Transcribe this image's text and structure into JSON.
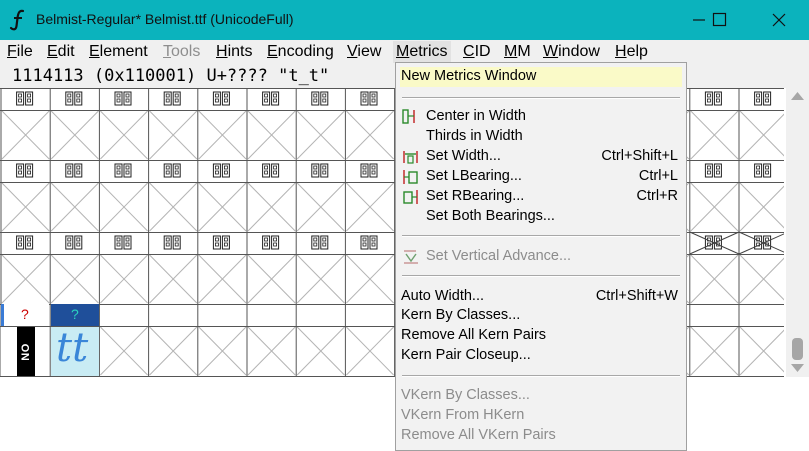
{
  "window": {
    "title": "Belmist-Regular*  Belmist.ttf (UnicodeFull)",
    "accent": "#0bb3bd"
  },
  "menubar": [
    {
      "label": "File",
      "state": "normal"
    },
    {
      "label": "Edit",
      "state": "normal"
    },
    {
      "label": "Element",
      "state": "normal"
    },
    {
      "label": "Tools",
      "state": "disabled"
    },
    {
      "label": "Hints",
      "state": "normal"
    },
    {
      "label": "Encoding",
      "state": "normal"
    },
    {
      "label": "View",
      "state": "normal"
    },
    {
      "label": "Metrics",
      "state": "active"
    },
    {
      "label": "CID",
      "state": "normal"
    },
    {
      "label": "MM",
      "state": "normal"
    },
    {
      "label": "Window",
      "state": "normal"
    },
    {
      "label": "Help",
      "state": "normal"
    }
  ],
  "infobar": {
    "text": "1114113 (0x110001) U+???? \"t_t\""
  },
  "glyph_grid": {
    "empty_label_glyph": "⊡⊡",
    "last_row": [
      {
        "label": "?",
        "glyph": "NO GLYPH"
      },
      {
        "label": "?",
        "glyph": "tt"
      }
    ]
  },
  "metrics_menu": {
    "items": [
      {
        "type": "item",
        "label": "New Metrics Window",
        "shortcut": "",
        "icon": "",
        "state": "highlighted"
      },
      {
        "type": "sep"
      },
      {
        "type": "item",
        "label": "Center in Width",
        "shortcut": "",
        "icon": "center-width-icon",
        "state": "enabled"
      },
      {
        "type": "item",
        "label": "Thirds in Width",
        "shortcut": "",
        "icon": "",
        "state": "enabled"
      },
      {
        "type": "item",
        "label": "Set Width...",
        "shortcut": "Ctrl+Shift+L",
        "icon": "set-width-icon",
        "state": "enabled"
      },
      {
        "type": "item",
        "label": "Set LBearing...",
        "shortcut": "Ctrl+L",
        "icon": "set-lbearing-icon",
        "state": "enabled"
      },
      {
        "type": "item",
        "label": "Set RBearing...",
        "shortcut": "Ctrl+R",
        "icon": "set-rbearing-icon",
        "state": "enabled"
      },
      {
        "type": "item",
        "label": "Set Both Bearings...",
        "shortcut": "",
        "icon": "",
        "state": "enabled"
      },
      {
        "type": "sep"
      },
      {
        "type": "item",
        "label": "Set Vertical Advance...",
        "shortcut": "",
        "icon": "vertical-advance-icon",
        "state": "disabled"
      },
      {
        "type": "sep"
      },
      {
        "type": "item",
        "label": "Auto Width...",
        "shortcut": "Ctrl+Shift+W",
        "icon": "",
        "state": "enabled"
      },
      {
        "type": "item",
        "label": "Kern By Classes...",
        "shortcut": "",
        "icon": "",
        "state": "enabled"
      },
      {
        "type": "item",
        "label": "Remove All Kern Pairs",
        "shortcut": "",
        "icon": "",
        "state": "enabled"
      },
      {
        "type": "item",
        "label": "Kern Pair Closeup...",
        "shortcut": "",
        "icon": "",
        "state": "enabled"
      },
      {
        "type": "sep"
      },
      {
        "type": "item",
        "label": "VKern By Classes...",
        "shortcut": "",
        "icon": "",
        "state": "disabled"
      },
      {
        "type": "item",
        "label": "VKern From HKern",
        "shortcut": "",
        "icon": "",
        "state": "disabled"
      },
      {
        "type": "item",
        "label": "Remove All VKern Pairs",
        "shortcut": "",
        "icon": "",
        "state": "disabled"
      }
    ]
  }
}
